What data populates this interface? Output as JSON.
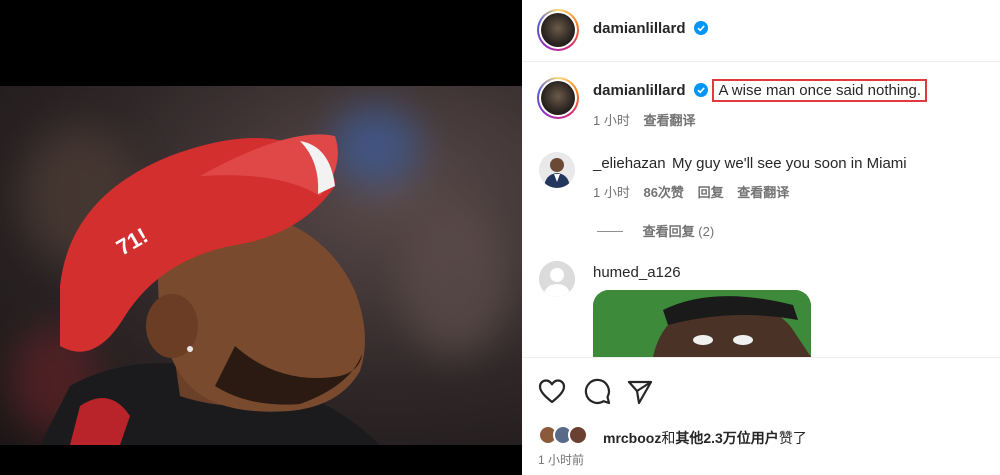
{
  "post": {
    "author": "damianlillard",
    "caption": "A wise man once said nothing.",
    "caption_time": "1 小时",
    "caption_translate": "查看翻译"
  },
  "comments": [
    {
      "user": "_eliehazan",
      "text": "My guy we'll see you soon in Miami",
      "time": "1 小时",
      "likes": "86次赞",
      "reply": "回复",
      "translate": "查看翻译",
      "view_replies": "查看回复",
      "reply_count": "(2)"
    },
    {
      "user": "humed_a126"
    }
  ],
  "likes": {
    "user": "mrcbooz",
    "and": "和",
    "others": "其他2.3万位用户",
    "suffix": "赞了"
  },
  "timestamp": "1 小时前",
  "colors": {
    "verified": "#0095f6",
    "highlight": "#e0393e",
    "cap": "#d42f2f"
  },
  "icons": [
    "verified-icon",
    "heart-icon",
    "comment-icon",
    "share-icon"
  ]
}
